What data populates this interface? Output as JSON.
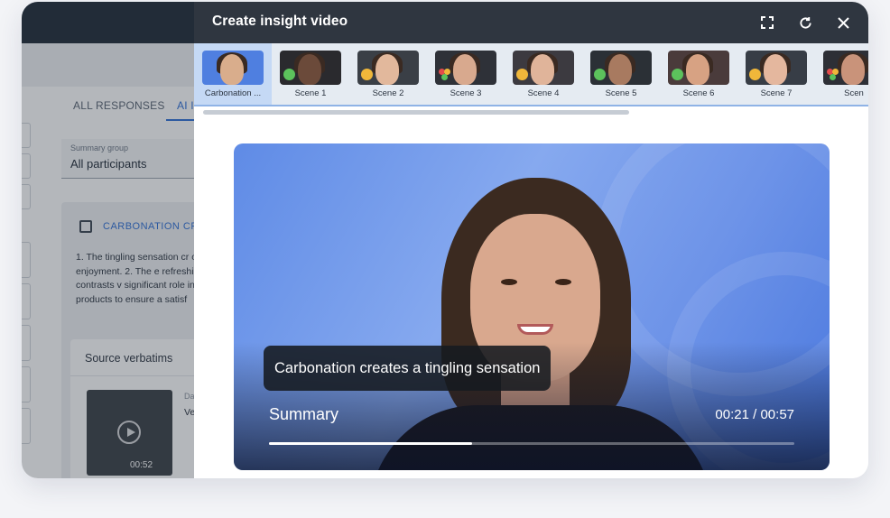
{
  "background_app": {
    "tabs": {
      "all_responses": "ALL RESPONSES",
      "ai": "AI I"
    },
    "summary_group": {
      "label": "Summary group",
      "value": "All participants"
    },
    "insight_card": {
      "title": "CARBONATION CR",
      "body": "1. The tingling sensation cr overall enjoyment. 2. The e refreshing. This contrasts v significant role in the refre products to ensure a satisf"
    },
    "source_verbatims": {
      "title": "Source verbatims",
      "clip_duration": "00:52",
      "date_label": "Da",
      "text": "Ve en sol"
    }
  },
  "modal": {
    "title": "Create insight video",
    "header_icons": [
      "fullscreen-icon",
      "refresh-icon",
      "close-icon"
    ],
    "scenes": [
      {
        "label": "Carbonation ...",
        "active": true,
        "emoji": ""
      },
      {
        "label": "Scene 1",
        "active": false,
        "emoji": "green"
      },
      {
        "label": "Scene 2",
        "active": false,
        "emoji": "yellow"
      },
      {
        "label": "Scene 3",
        "active": false,
        "emoji": "mixed"
      },
      {
        "label": "Scene 4",
        "active": false,
        "emoji": "yellow"
      },
      {
        "label": "Scene 5",
        "active": false,
        "emoji": "green"
      },
      {
        "label": "Scene 6",
        "active": false,
        "emoji": "green"
      },
      {
        "label": "Scene 7",
        "active": false,
        "emoji": "yellow"
      },
      {
        "label": "Scen",
        "active": false,
        "emoji": "mixed"
      }
    ],
    "player": {
      "caption": "Carbonation creates a tingling sensation",
      "section_title": "Summary",
      "time": "00:21 / 00:57",
      "progress": 0.386
    }
  },
  "colors": {
    "header_bg": "#2f3640",
    "accent": "#2f6fd6",
    "scene_active_bg": "#c5d9f5",
    "emoji_green": "#5cc25c",
    "emoji_yellow": "#f0b73a"
  }
}
